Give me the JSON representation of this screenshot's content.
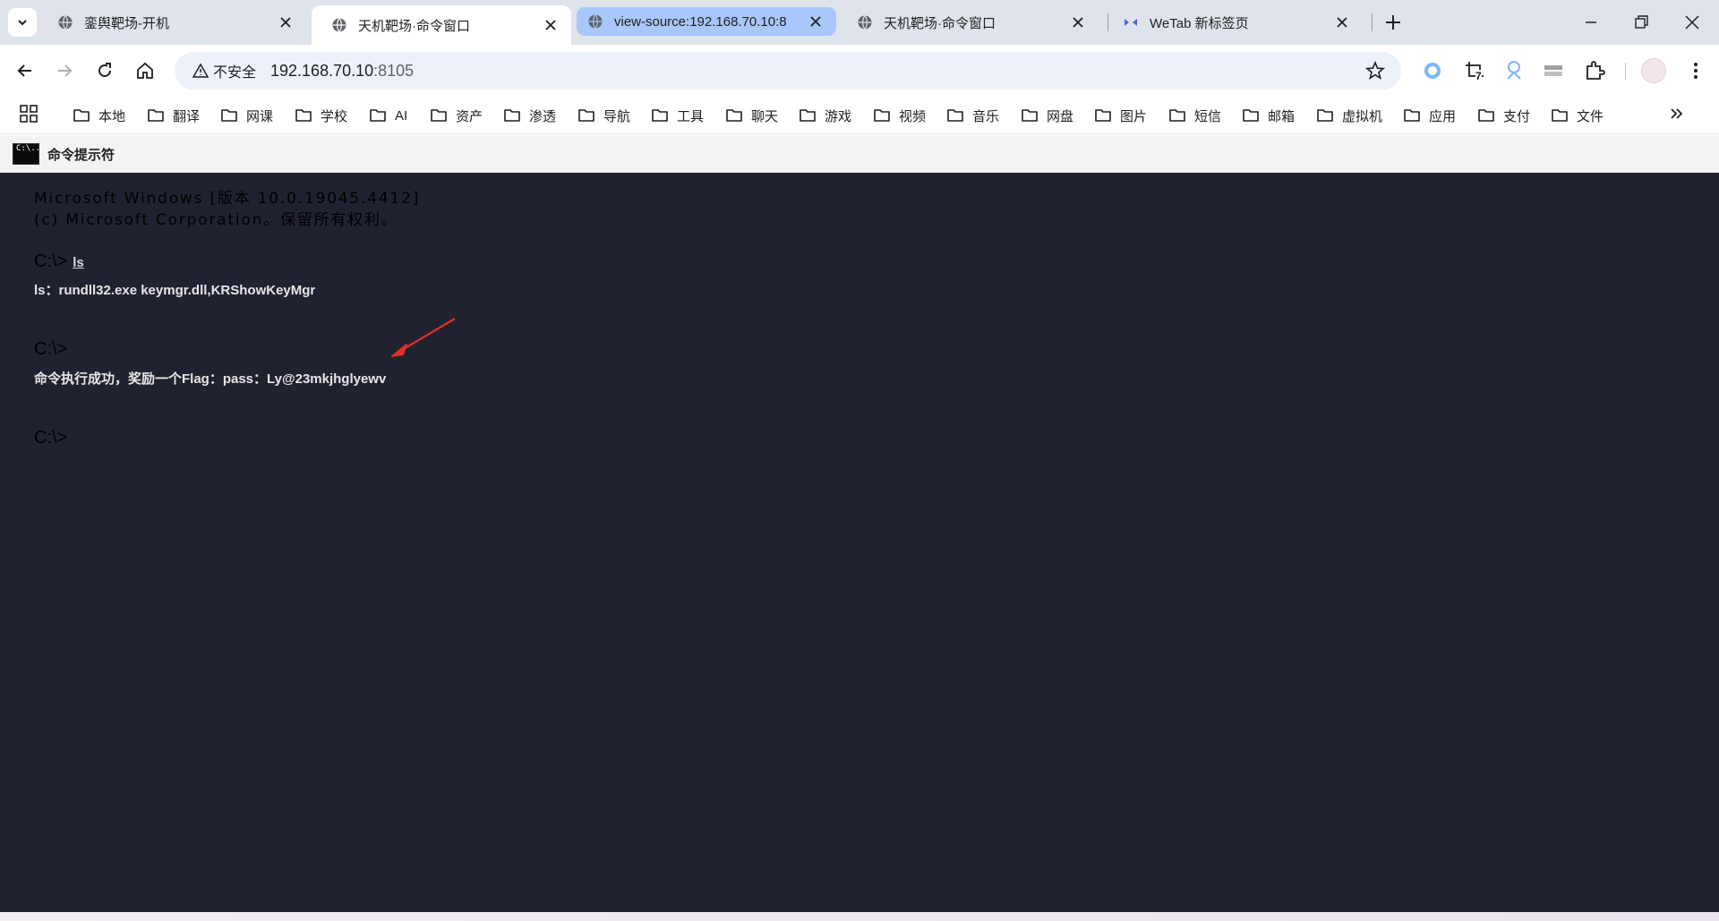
{
  "tabs": [
    {
      "title": "銮舆靶场-开机",
      "state": "normal"
    },
    {
      "title": "天机靶场·命令窗口",
      "state": "active"
    },
    {
      "title": "view-source:192.168.70.10:8",
      "state": "highlighted"
    },
    {
      "title": "天机靶场·命令窗口",
      "state": "normal"
    },
    {
      "title": "WeTab 新标签页",
      "state": "normal"
    }
  ],
  "toolbar": {
    "security_label": "不安全",
    "url_host": "192.168.70.10",
    "url_rest": ":8105",
    "extension_badge": "7"
  },
  "bookmarks": [
    "本地",
    "翻译",
    "网课",
    "学校",
    "AI",
    "资产",
    "渗透",
    "导航",
    "工具",
    "聊天",
    "游戏",
    "视频",
    "音乐",
    "网盘",
    "图片",
    "短信",
    "邮箱",
    "虚拟机",
    "应用",
    "支付",
    "文件"
  ],
  "page": {
    "icon_text": "C:\\..",
    "title": "命令提示符"
  },
  "terminal": {
    "banner_line1": "Microsoft Windows [版本 10.0.19045.4412]",
    "banner_line2": "(c) Microsoft Corporation。保留所有权利。",
    "prompt1": "C:\\>",
    "command1": "ls",
    "output1": "ls：rundll32.exe keymgr.dll,KRShowKeyMgr",
    "prompt2": "C:\\>",
    "output2": "命令执行成功，奖励一个Flag：pass：Ly@23mkjhglyewv",
    "prompt3": "C:\\>"
  },
  "colors": {
    "terminal_bg": "#21222f",
    "tabstrip_bg": "#dfe3eb",
    "highlight_tab": "#a8c7fa",
    "annotation_arrow": "#e0302a"
  }
}
